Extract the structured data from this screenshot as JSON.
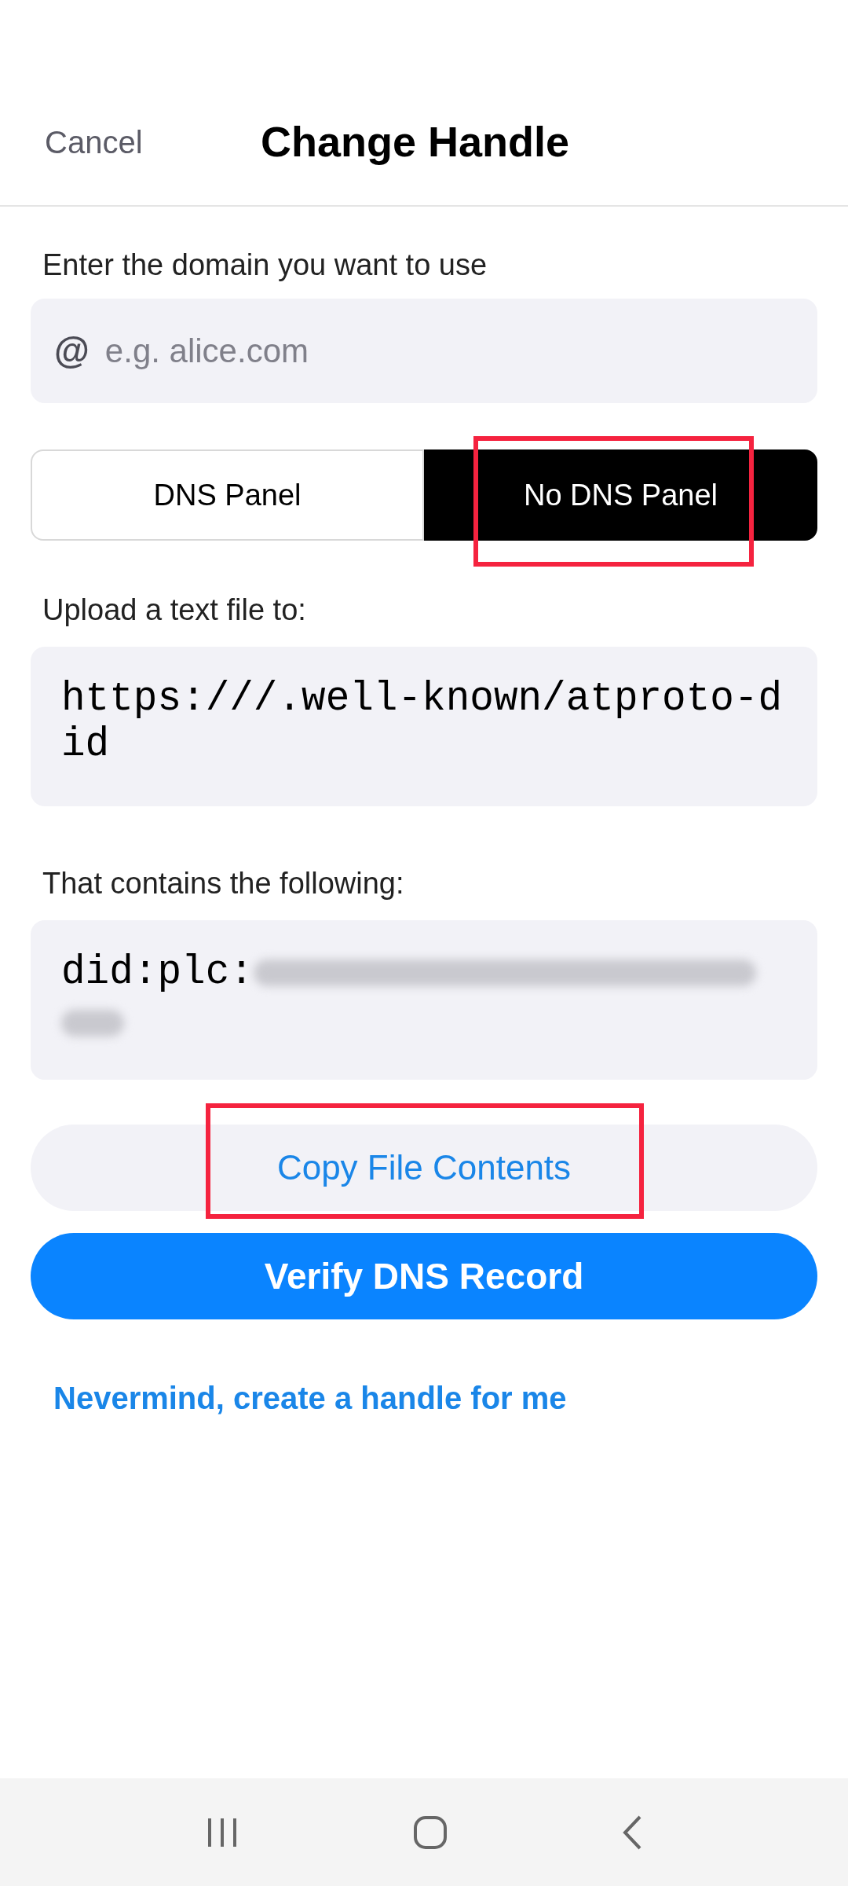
{
  "header": {
    "cancel": "Cancel",
    "title": "Change Handle"
  },
  "domain": {
    "label": "Enter the domain you want to use",
    "prefix": "@",
    "placeholder": "e.g. alice.com"
  },
  "segments": [
    {
      "label": "DNS Panel",
      "selected": false,
      "highlighted": false
    },
    {
      "label": "No DNS Panel",
      "selected": true,
      "highlighted": true
    }
  ],
  "upload": {
    "label": "Upload a text file to:",
    "value": "https:///.well-known/atproto-did"
  },
  "contents": {
    "label": "That contains the following:",
    "value": "did:plc:",
    "redacted": true
  },
  "copy_button": {
    "label": "Copy File Contents",
    "highlighted": true
  },
  "verify_button": {
    "label": "Verify DNS Record"
  },
  "link": "Nevermind, create a handle for me"
}
